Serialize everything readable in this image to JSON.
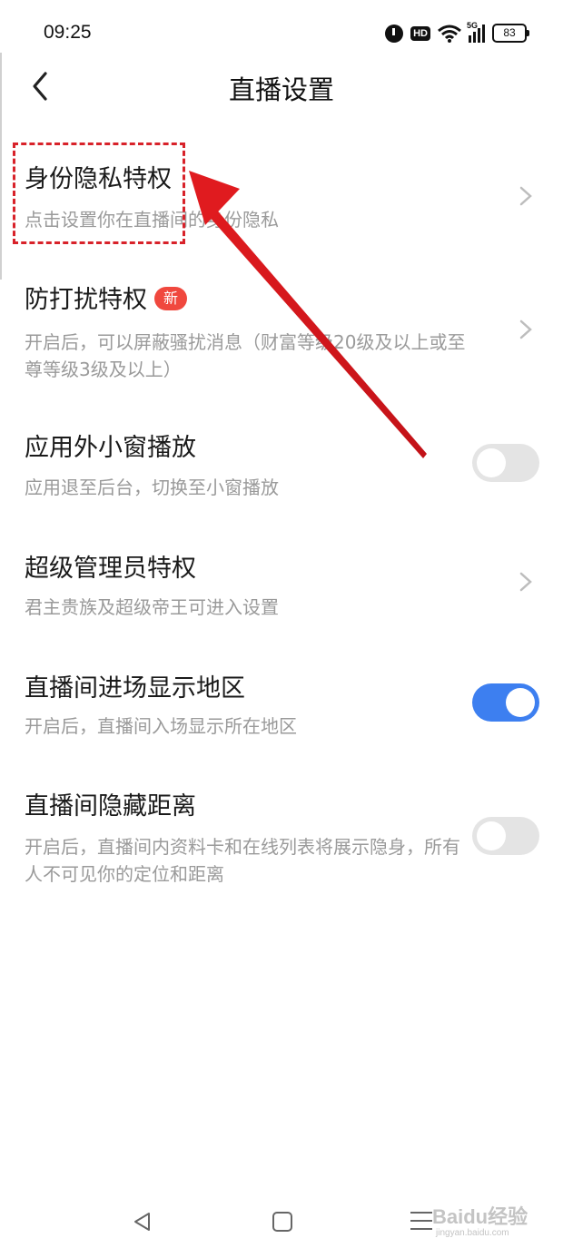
{
  "status_bar": {
    "time": "09:25",
    "hd_label": "HD",
    "network": "5G",
    "battery": "83"
  },
  "header": {
    "title": "直播设置",
    "back_icon": "chevron-left-icon"
  },
  "settings": [
    {
      "title": "身份隐私特权",
      "desc": "点击设置你在直播间的身份隐私",
      "control": "chevron"
    },
    {
      "title": "防打扰特权",
      "badge": "新",
      "desc": "开启后，可以屏蔽骚扰消息（财富等级20级及以上或至尊等级3级及以上）",
      "control": "chevron"
    },
    {
      "title": "应用外小窗播放",
      "desc": "应用退至后台，切换至小窗播放",
      "control": "toggle",
      "enabled": false
    },
    {
      "title": "超级管理员特权",
      "desc": "君主贵族及超级帝王可进入设置",
      "control": "chevron"
    },
    {
      "title": "直播间进场显示地区",
      "desc": "开启后，直播间入场显示所在地区",
      "control": "toggle",
      "enabled": true
    },
    {
      "title": "直播间隐藏距离",
      "desc": "开启后，直播间内资料卡和在线列表将展示隐身，所有人不可见你的定位和距离",
      "control": "toggle",
      "enabled": false
    }
  ],
  "watermark": {
    "text": "Baidu经验",
    "sub": "jingyan.baidu.com"
  },
  "colors": {
    "toggle_on": "#3d7ff0",
    "toggle_off": "#e4e4e4",
    "badge": "#f0483e",
    "annotation": "#d8222a"
  }
}
